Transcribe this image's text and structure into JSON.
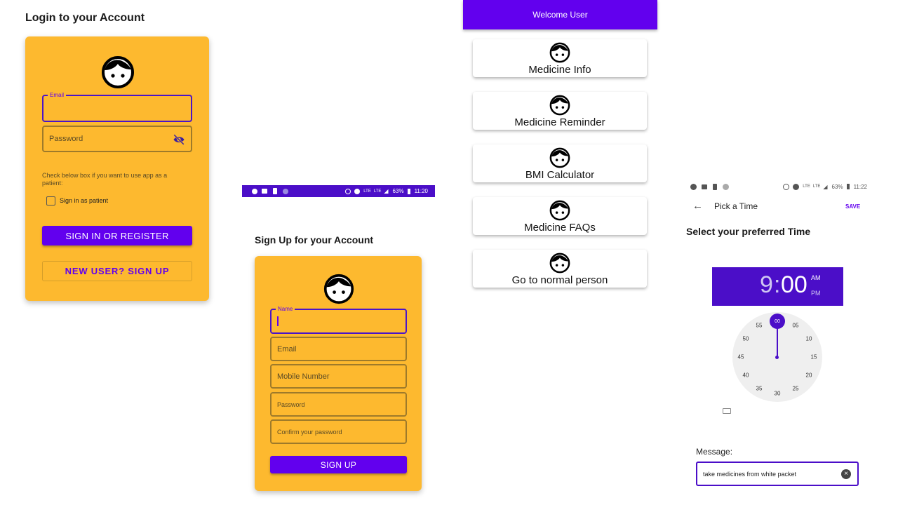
{
  "login": {
    "title": "Login to your Account",
    "email_label": "Email",
    "password_placeholder": "Password",
    "hint": "Check below box if you want to use app as a patient:",
    "checkbox_label": "Sign in as patient",
    "signin_button": "SIGN IN OR REGISTER",
    "signup_button": "NEW USER? SIGN UP"
  },
  "signup": {
    "status": {
      "battery": "63%",
      "time": "11:20",
      "net1": "LTE",
      "net2": "LTE"
    },
    "title": "Sign Up for your Account",
    "name_label": "Name",
    "email_placeholder": "Email",
    "mobile_placeholder": "Mobile Number",
    "password_placeholder": "Password",
    "confirm_placeholder": "Confirm your password",
    "signup_button": "SIGN UP"
  },
  "home": {
    "header": "Welcome User",
    "items": [
      {
        "label": "Medicine Info"
      },
      {
        "label": "Medicine Reminder"
      },
      {
        "label": "BMI Calculator"
      },
      {
        "label": "Medicine FAQs"
      },
      {
        "label": "Go to normal person"
      }
    ]
  },
  "time": {
    "status": {
      "battery": "63%",
      "time": "11:22",
      "net1": "LTE",
      "net2": "LTE"
    },
    "title": "Pick a Time",
    "save": "SAVE",
    "subtitle": "Select your preferred Time",
    "hour": "9",
    "colon": ":",
    "minute": "00",
    "am": "AM",
    "pm": "PM",
    "selected_minute": "00",
    "clock_numbers": [
      "05",
      "10",
      "15",
      "20",
      "25",
      "30",
      "35",
      "40",
      "45",
      "50",
      "55"
    ],
    "message_label": "Message:",
    "message_value": "take medicines from white packet"
  },
  "colors": {
    "accent": "#6200EE",
    "card": "#FDB92F",
    "time_header": "#4B0EC8"
  }
}
